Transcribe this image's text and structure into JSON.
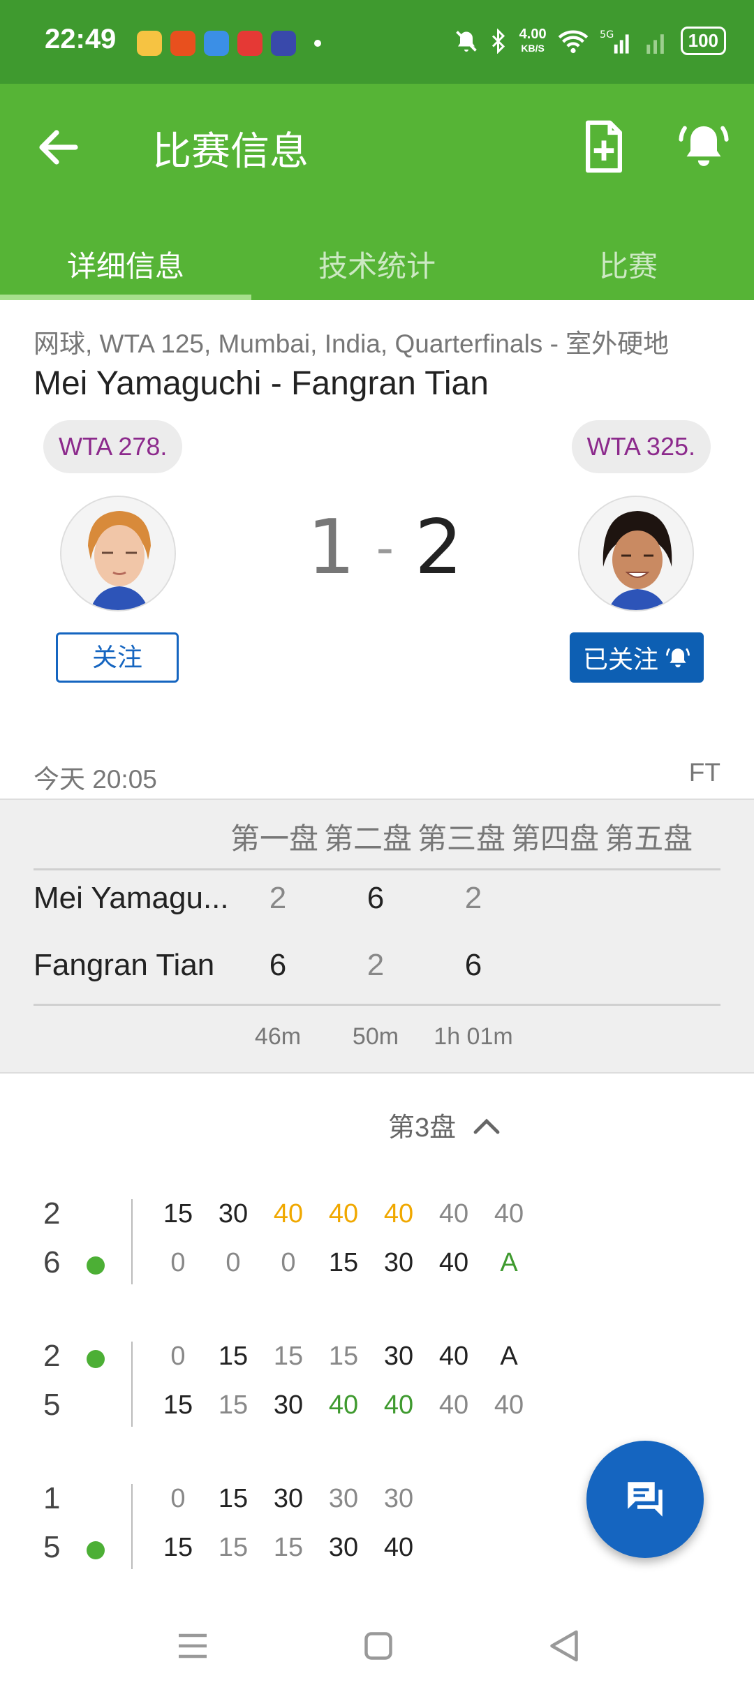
{
  "status_bar": {
    "time": "22:49",
    "net_speed_value": "4.00",
    "net_speed_unit": "KB/S",
    "battery": "100",
    "signal_label": "5G"
  },
  "app_bar": {
    "title": "比赛信息",
    "tabs": [
      "详细信息",
      "技术统计",
      "比赛"
    ]
  },
  "match": {
    "meta": "网球, WTA 125, Mumbai, India, Quarterfinals - 室外硬地",
    "title": "Mei Yamaguchi - Fangran Tian",
    "rank_left": "WTA 278.",
    "rank_right": "WTA 325.",
    "score_left": "1",
    "score_sep": "-",
    "score_right": "2",
    "follow_label": "关注",
    "following_label": "已关注",
    "date": "今天 20:05",
    "status": "FT"
  },
  "sets": {
    "headers": [
      "第一盘",
      "第二盘",
      "第三盘",
      "第四盘",
      "第五盘"
    ],
    "players": [
      {
        "name": "Mei Yamagu...",
        "scores": [
          "2",
          "6",
          "2"
        ]
      },
      {
        "name": "Fangran Tian",
        "scores": [
          "6",
          "2",
          "6"
        ]
      }
    ],
    "durations": [
      "46m",
      "50m",
      "1h 01m"
    ]
  },
  "set_detail": {
    "label": "第3盘"
  },
  "games": [
    {
      "top_score": "2",
      "bottom_score": "6",
      "server": "bottom",
      "top_points": [
        "15",
        "30",
        "40",
        "40",
        "40",
        "40",
        "40"
      ],
      "top_colors": [
        "dark",
        "dark",
        "orange",
        "orange",
        "orange",
        "grey",
        "grey"
      ],
      "bottom_points": [
        "0",
        "0",
        "0",
        "15",
        "30",
        "40",
        "A"
      ],
      "bottom_colors": [
        "grey",
        "grey",
        "grey",
        "dark",
        "dark",
        "dark",
        "green"
      ]
    },
    {
      "top_score": "2",
      "bottom_score": "5",
      "server": "top",
      "top_points": [
        "0",
        "15",
        "15",
        "15",
        "30",
        "40",
        "A"
      ],
      "top_colors": [
        "grey",
        "dark",
        "grey",
        "grey",
        "dark",
        "dark",
        "dark"
      ],
      "bottom_points": [
        "15",
        "15",
        "30",
        "40",
        "40",
        "40",
        "40"
      ],
      "bottom_colors": [
        "dark",
        "grey",
        "dark",
        "green",
        "green",
        "grey",
        "grey"
      ]
    },
    {
      "top_score": "1",
      "bottom_score": "5",
      "server": "bottom",
      "top_points": [
        "0",
        "15",
        "30",
        "30",
        "30"
      ],
      "top_colors": [
        "grey",
        "dark",
        "dark",
        "grey",
        "grey"
      ],
      "bottom_points": [
        "15",
        "15",
        "15",
        "30",
        "40"
      ],
      "bottom_colors": [
        "dark",
        "grey",
        "grey",
        "dark",
        "dark"
      ]
    }
  ],
  "colors": {
    "status_bar": "#3f9a2f",
    "app_bar": "#56b436",
    "accent_blue": "#1565c0",
    "rank_text": "#8c2a8c",
    "break_point": "#f0a800",
    "game_won": "#3f9a2f"
  },
  "icons": [
    "back-arrow-icon",
    "add-document-icon",
    "bell-ring-icon",
    "chat-icon",
    "menu-icon",
    "home-icon",
    "back-triangle-icon"
  ]
}
